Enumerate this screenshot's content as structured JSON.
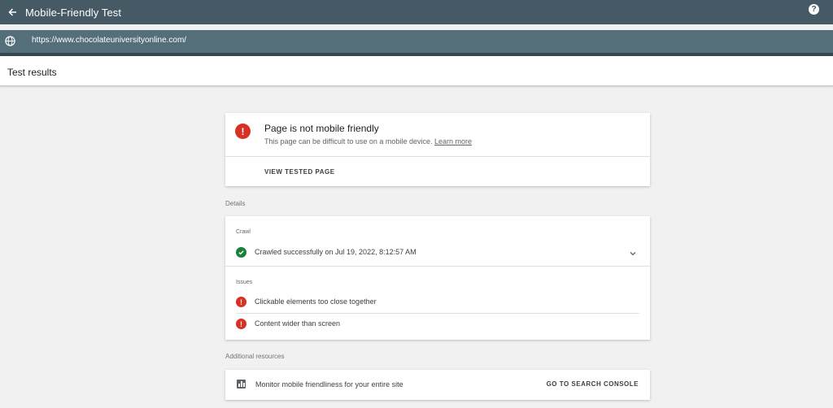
{
  "app": {
    "title": "Mobile-Friendly Test",
    "help_glyph": "?"
  },
  "urlbar": {
    "url": "https://www.chocolateuniversityonline.com/"
  },
  "results_header": {
    "label": "Test results"
  },
  "verdict": {
    "headline": "Page is not mobile friendly",
    "subtitle": "This page can be difficult to use on a mobile device.",
    "learn_more": "Learn more",
    "view_tested_page": "VIEW TESTED PAGE",
    "status_color": "#d93025"
  },
  "details": {
    "section_label": "Details",
    "crawl_label": "Crawl",
    "crawl_status": "Crawled successfully on Jul 19, 2022, 8:12:57 AM",
    "issues_label": "Issues",
    "issues": [
      {
        "text": "Clickable elements too close together",
        "icon": "error-icon"
      },
      {
        "text": "Content wider than screen",
        "icon": "error-icon"
      }
    ],
    "success_color": "#188038"
  },
  "additional": {
    "section_label": "Additional resources",
    "monitor_text": "Monitor mobile friendliness for your entire site",
    "console_link": "GO TO SEARCH CONSOLE"
  }
}
